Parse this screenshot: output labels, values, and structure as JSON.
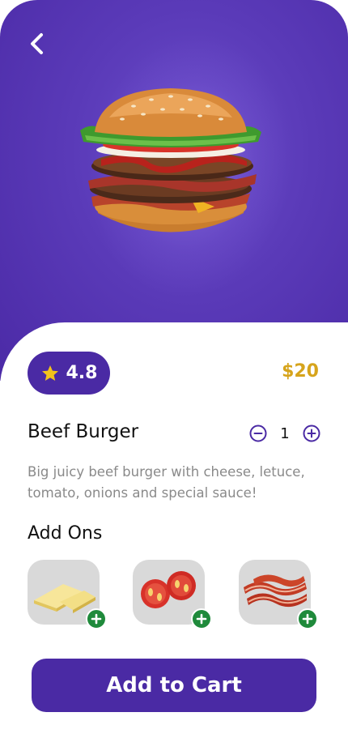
{
  "colors": {
    "primary": "#4a2aa4",
    "price": "#d6a41c",
    "addon_bg": "#d9d9d9",
    "plus_badge": "#1f8a3b"
  },
  "nav": {
    "back_icon": "chevron-left-icon"
  },
  "product": {
    "image": "beef-burger-photo",
    "rating": "4.8",
    "rating_icon": "star-icon",
    "price": "$20",
    "name": "Beef Burger",
    "quantity": "1",
    "description": "Big juicy beef burger with cheese, letuce, tomato, onions and special sauce!"
  },
  "addons": {
    "title": "Add Ons",
    "items": [
      {
        "image": "cheese-slices"
      },
      {
        "image": "tomato-slices"
      },
      {
        "image": "bacon-strips"
      }
    ]
  },
  "cart": {
    "label": "Add to Cart"
  }
}
